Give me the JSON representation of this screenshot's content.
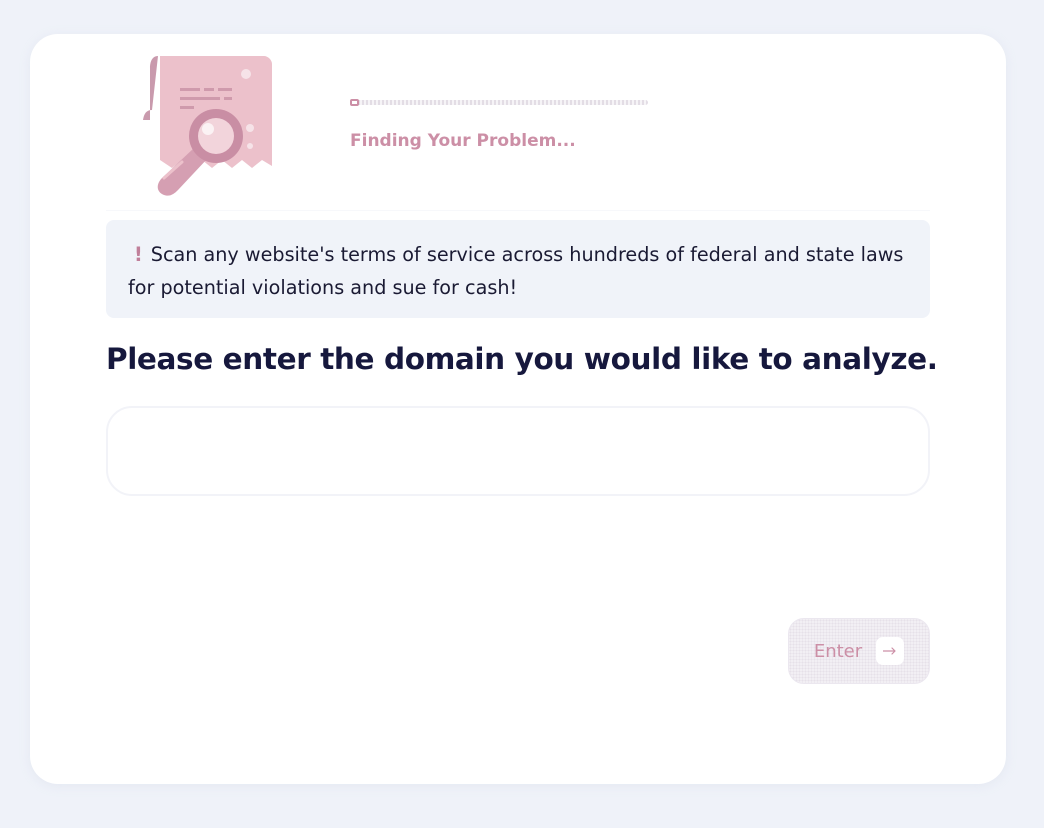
{
  "progress": {
    "fraction": 0.03,
    "status": "Finding Your Problem..."
  },
  "notice": {
    "icon": "exclamation-icon",
    "text": "Scan any website's terms of service across hundreds of federal and state laws for potential violations and sue for cash!"
  },
  "form": {
    "heading": "Please enter the domain you would like to analyze.",
    "domain_value": "",
    "domain_placeholder": ""
  },
  "button": {
    "label": "Enter",
    "icon": "arrow-right-icon"
  },
  "colors": {
    "accent": "#cc8fa6",
    "heading": "#16183d",
    "background": "#eff2f9",
    "notice_bg": "#f0f3f9"
  }
}
